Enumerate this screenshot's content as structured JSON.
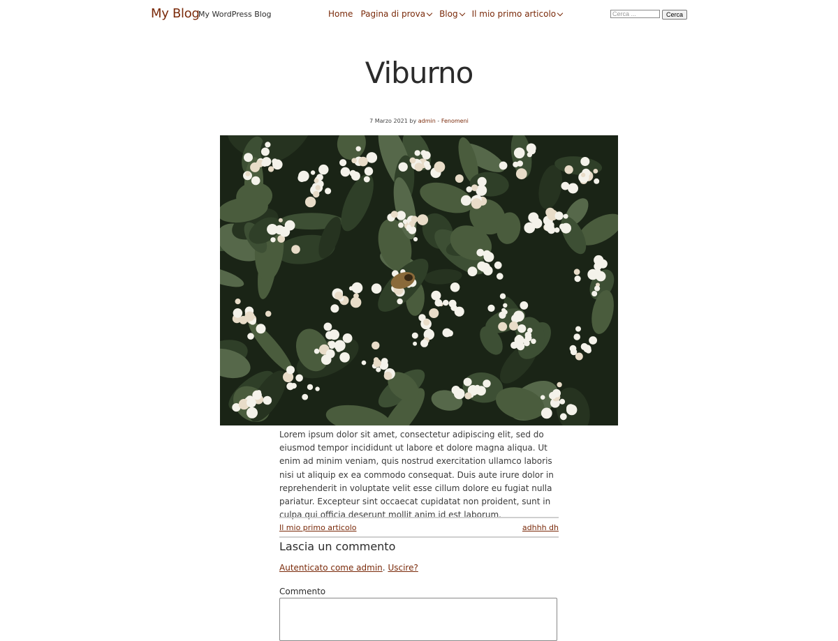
{
  "header": {
    "site_title": "My Blog",
    "tagline": "My WordPress Blog",
    "nav": [
      {
        "label": "Home",
        "has_submenu": false
      },
      {
        "label": "Pagina di prova",
        "has_submenu": true
      },
      {
        "label": "Blog",
        "has_submenu": true
      },
      {
        "label": "Il mio primo articolo",
        "has_submenu": true
      }
    ],
    "search": {
      "placeholder": "Cerca ...",
      "button_label": "Cerca"
    }
  },
  "post": {
    "title": "Viburno",
    "meta": {
      "date": "7 Marzo 2021",
      "by": "by",
      "author": "admin",
      "separator": "-",
      "category": "Fenomeni"
    },
    "image": {
      "subject": "white viburnum flower clusters with dark green leaves and a bee"
    },
    "content": "Lorem ipsum dolor sit amet, consectetur adipiscing elit, sed do eiusmod tempor incididunt ut labore et dolore magna aliqua. Ut enim ad minim veniam, quis nostrud exercitation ullamco laboris nisi ut aliquip ex ea commodo consequat. Duis aute irure dolor in reprehenderit in voluptate velit esse cillum dolore eu fugiat nulla pariatur. Excepteur sint occaecat cupidatat non proident, sunt in culpa qui officia deserunt mollit anim id est laborum."
  },
  "post_navigation": {
    "previous": "Il mio primo articolo",
    "next": "adhhh dh"
  },
  "comments": {
    "reply_title": "Lascia un commento",
    "logged_in_link": "Autenticato come admin",
    "logged_in_sep": ".",
    "logout_link": "Uscire?",
    "comment_label": "Commento"
  },
  "colors": {
    "accent": "#7a2a0a",
    "text": "#2b2b2b",
    "background": "#ffffff"
  }
}
